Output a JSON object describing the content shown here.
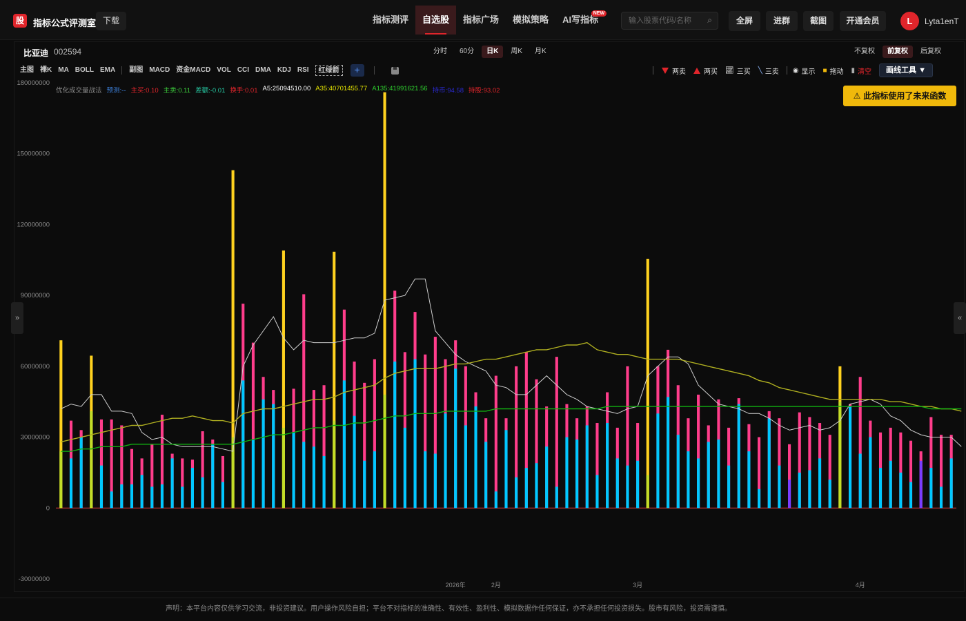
{
  "app": {
    "logo_char": "股",
    "title": "指标公式评测室",
    "download": "下载"
  },
  "nav": [
    {
      "label": "指标测评",
      "active": false
    },
    {
      "label": "自选股",
      "active": true
    },
    {
      "label": "指标广场",
      "active": false
    },
    {
      "label": "模拟策略",
      "active": false
    },
    {
      "label": "AI写指标",
      "active": false,
      "badge": "NEW"
    }
  ],
  "search": {
    "placeholder": "输入股票代码/名称"
  },
  "top_buttons": {
    "fullscreen": "全屏",
    "join_group": "进群",
    "screenshot": "截图",
    "vip": "开通会员"
  },
  "user": {
    "avatar": "L",
    "name": "Lyta1enT"
  },
  "stock": {
    "name": "比亚迪",
    "code": "002594"
  },
  "periods": [
    {
      "label": "分时",
      "active": false
    },
    {
      "label": "60分",
      "active": false
    },
    {
      "label": "日K",
      "active": true
    },
    {
      "label": "周K",
      "active": false
    },
    {
      "label": "月K",
      "active": false
    }
  ],
  "adjust": [
    {
      "label": "不复权",
      "active": false
    },
    {
      "label": "前复权",
      "active": true
    },
    {
      "label": "后复权",
      "active": false
    }
  ],
  "indicators_main": [
    "主图",
    "裸K",
    "MA",
    "BOLL",
    "EMA"
  ],
  "indicators_sub": [
    "副图",
    "MACD",
    "资金MACD",
    "VOL",
    "CCI",
    "DMA",
    "KDJ",
    "RSI"
  ],
  "indicator_custom": "红绿箭",
  "plus_symbol": "+",
  "draw_tools": {
    "sell2": "两卖",
    "buy2": "两买",
    "buy3": "三买",
    "sell3": "三卖",
    "show": "显示",
    "drag": "拖动",
    "clear": "清空",
    "draw_tool": "画线工具 ▼"
  },
  "legend": [
    {
      "text": "优化成交量战法",
      "color": "#8a8a8a"
    },
    {
      "text": "预测:--",
      "color": "#3c7fd8"
    },
    {
      "text": "主买:0.10",
      "color": "#e0252b"
    },
    {
      "text": "主卖:0.11",
      "color": "#3dcf3d"
    },
    {
      "text": "差额:-0.01",
      "color": "#26c6a0"
    },
    {
      "text": "换手:0.01",
      "color": "#e0252b"
    },
    {
      "text": "A5:25094510.00",
      "color": "#ffffff"
    },
    {
      "text": "A35:40701455.77",
      "color": "#e6e600"
    },
    {
      "text": "A135:41991621.56",
      "color": "#2fd02f"
    },
    {
      "text": "持币:94.58",
      "color": "#2a2ad0"
    },
    {
      "text": "持股:93.02",
      "color": "#e0252b"
    }
  ],
  "warning": "此指标使用了未来函数",
  "side_toggles": {
    "left": "»",
    "right": "«"
  },
  "disclaimer": "声明：本平台内容仅供学习交流，非投资建议。用户操作风险自担；平台不对指标的准确性、有效性、盈利性、模拟数据作任何保证，亦不承担任何投资损失。股市有风险，投资需谨慎。",
  "colors": {
    "accent": "#e0252b",
    "pink": "#ff3d8b",
    "cyan": "#00c8ff",
    "yellow": "#ffd21f",
    "olive": "#b0b020",
    "green": "#10b010",
    "gray_line": "#d0d0d0"
  },
  "chart_data": {
    "type": "bar",
    "ylim": [
      -30000000,
      180000000
    ],
    "yticks": [
      180000000,
      150000000,
      120000000,
      90000000,
      60000000,
      30000000,
      0,
      -30000000
    ],
    "x_labels": [
      {
        "label": "2026年",
        "index": 39
      },
      {
        "label": "2月",
        "index": 43
      },
      {
        "label": "3月",
        "index": 57
      },
      {
        "label": "4月",
        "index": 79
      }
    ],
    "bars": [
      {
        "total": 71,
        "cyan": 24,
        "kind": "yellow"
      },
      {
        "total": 37,
        "cyan": 21
      },
      {
        "total": 33,
        "cyan": 30
      },
      {
        "total": 64.5,
        "cyan": 41,
        "kind": "yellow"
      },
      {
        "total": 37.5,
        "cyan": 18
      },
      {
        "total": 37.5,
        "cyan": 7
      },
      {
        "total": 35,
        "cyan": 10
      },
      {
        "total": 25,
        "cyan": 10
      },
      {
        "total": 21,
        "cyan": 14
      },
      {
        "total": 27,
        "cyan": 9
      },
      {
        "total": 39.5,
        "cyan": 10
      },
      {
        "total": 23,
        "cyan": 21
      },
      {
        "total": 21,
        "cyan": 9
      },
      {
        "total": 20.5,
        "cyan": 17
      },
      {
        "total": 32.5,
        "cyan": 13
      },
      {
        "total": 29,
        "cyan": 27
      },
      {
        "total": 22,
        "cyan": 11
      },
      {
        "total": 143,
        "cyan": 30,
        "kind": "yellow"
      },
      {
        "total": 86.5,
        "cyan": 54
      },
      {
        "total": 70,
        "cyan": 29
      },
      {
        "total": 55.5,
        "cyan": 46
      },
      {
        "total": 50,
        "cyan": 44
      },
      {
        "total": 109,
        "cyan": 34,
        "kind": "yellow"
      },
      {
        "total": 50.5,
        "cyan": 32
      },
      {
        "total": 90.5,
        "cyan": 28
      },
      {
        "total": 50,
        "cyan": 26
      },
      {
        "total": 52,
        "cyan": 22
      },
      {
        "total": 108.5,
        "cyan": 37,
        "kind": "yellow"
      },
      {
        "total": 84,
        "cyan": 54
      },
      {
        "total": 62,
        "cyan": 39
      },
      {
        "total": 53,
        "cyan": 20
      },
      {
        "total": 63,
        "cyan": 24
      },
      {
        "total": 176,
        "cyan": 48,
        "kind": "yellow"
      },
      {
        "total": 92,
        "cyan": 62
      },
      {
        "total": 66,
        "cyan": 34
      },
      {
        "total": 83,
        "cyan": 63
      },
      {
        "total": 65,
        "cyan": 24
      },
      {
        "total": 72.5,
        "cyan": 23
      },
      {
        "total": 63,
        "cyan": 40
      },
      {
        "total": 71,
        "cyan": 59
      },
      {
        "total": 60,
        "cyan": 35
      },
      {
        "total": 49,
        "cyan": 43
      },
      {
        "total": 38,
        "cyan": 28
      },
      {
        "total": 56,
        "cyan": 7
      },
      {
        "total": 38,
        "cyan": 33
      },
      {
        "total": 60,
        "cyan": 13
      },
      {
        "total": 66,
        "cyan": 17
      },
      {
        "total": 54.5,
        "cyan": 19
      },
      {
        "total": 43,
        "cyan": 26
      },
      {
        "total": 64,
        "cyan": 9
      },
      {
        "total": 44,
        "cyan": 30
      },
      {
        "total": 38,
        "cyan": 29
      },
      {
        "total": 43,
        "cyan": 35
      },
      {
        "total": 36,
        "cyan": 14
      },
      {
        "total": 49,
        "cyan": 36
      },
      {
        "total": 34,
        "cyan": 21
      },
      {
        "total": 60,
        "cyan": 18
      },
      {
        "total": 36,
        "cyan": 20
      },
      {
        "total": 105.5,
        "cyan": 14,
        "kind": "yellow"
      },
      {
        "total": 60,
        "cyan": 40
      },
      {
        "total": 67,
        "cyan": 47
      },
      {
        "total": 52,
        "cyan": 31
      },
      {
        "total": 38,
        "cyan": 24
      },
      {
        "total": 48,
        "cyan": 21
      },
      {
        "total": 35,
        "cyan": 28
      },
      {
        "total": 46,
        "cyan": 29
      },
      {
        "total": 34,
        "cyan": 18
      },
      {
        "total": 46.5,
        "cyan": 44
      },
      {
        "total": 35.5,
        "cyan": 24
      },
      {
        "total": 30,
        "cyan": 8
      },
      {
        "total": 41,
        "cyan": 38
      },
      {
        "total": 38,
        "cyan": 18
      },
      {
        "total": 27,
        "cyan": 12,
        "kind": "purple"
      },
      {
        "total": 40.5,
        "cyan": 15
      },
      {
        "total": 38.5,
        "cyan": 16
      },
      {
        "total": 36,
        "cyan": 21
      },
      {
        "total": 31,
        "cyan": 12
      },
      {
        "total": 60,
        "cyan": 45,
        "kind": "yellow"
      },
      {
        "total": 44,
        "cyan": 43
      },
      {
        "total": 55.5,
        "cyan": 23
      },
      {
        "total": 37,
        "cyan": 30
      },
      {
        "total": 32,
        "cyan": 17
      },
      {
        "total": 34,
        "cyan": 20
      },
      {
        "total": 32,
        "cyan": 15
      },
      {
        "total": 28.5,
        "cyan": 11
      },
      {
        "total": 24,
        "cyan": 20,
        "kind": "purple"
      },
      {
        "total": 38.5,
        "cyan": 17
      },
      {
        "total": 31,
        "cyan": 9
      },
      {
        "total": 31,
        "cyan": 21
      }
    ],
    "value_unit": 1000000,
    "series": [
      {
        "key": "A5",
        "color": "#d0d0d0",
        "values": [
          42,
          44,
          43,
          48,
          48,
          41,
          41,
          40,
          32,
          29,
          30,
          27,
          26,
          26,
          26,
          26,
          25,
          24,
          60,
          69,
          75,
          81,
          72,
          67,
          71,
          70,
          70,
          70,
          71,
          72,
          72,
          74,
          88,
          89,
          90,
          97,
          97,
          75,
          70,
          65,
          62,
          60,
          58,
          52,
          51,
          48,
          48,
          52,
          56,
          52,
          48,
          46,
          43,
          42,
          41,
          40,
          42,
          43,
          56,
          60,
          64,
          64,
          61,
          52,
          48,
          44,
          43,
          42,
          40,
          40,
          38,
          35,
          33,
          34,
          35,
          33,
          34,
          37,
          44,
          45,
          46,
          44,
          39,
          37,
          33,
          31,
          30,
          30,
          30,
          26
        ]
      },
      {
        "key": "A35",
        "color": "#b0b020",
        "values": [
          28,
          29,
          30,
          31,
          32,
          33,
          34,
          35,
          35,
          36,
          37,
          38,
          38,
          39,
          38,
          37,
          37,
          36,
          40,
          41,
          42,
          42,
          43,
          44,
          45,
          46,
          46,
          47,
          49,
          50,
          51,
          52,
          55,
          57,
          58,
          59,
          59,
          59,
          60,
          61,
          61,
          62,
          63,
          63,
          64,
          65,
          66,
          67,
          67,
          68,
          69,
          69,
          70,
          67,
          66,
          65,
          65,
          64,
          63,
          63,
          63,
          63,
          62,
          61,
          60,
          59,
          58,
          57,
          56,
          54,
          53,
          51,
          50,
          49,
          48,
          47,
          46,
          46,
          46,
          46,
          46,
          46,
          45,
          45,
          44,
          43,
          43,
          42,
          42,
          41
        ]
      },
      {
        "key": "A135",
        "color": "#10b010",
        "values": [
          24,
          24,
          25,
          25,
          26,
          26,
          26,
          27,
          27,
          27,
          27,
          27,
          27,
          27,
          27,
          27,
          27,
          27,
          28,
          29,
          30,
          31,
          31,
          32,
          33,
          34,
          34,
          35,
          35,
          36,
          36,
          37,
          38,
          39,
          39,
          40,
          40,
          40,
          41,
          41,
          41,
          41,
          41,
          42,
          42,
          42,
          42,
          42,
          42,
          42,
          42,
          42,
          42,
          42,
          43,
          43,
          43,
          43,
          43,
          43,
          43,
          43,
          43,
          43,
          43,
          43,
          43,
          43,
          43,
          43,
          43,
          43,
          43,
          43,
          43,
          43,
          43,
          43,
          43,
          43,
          43,
          43,
          43,
          43,
          43,
          43,
          42,
          42,
          42,
          42
        ]
      }
    ]
  }
}
